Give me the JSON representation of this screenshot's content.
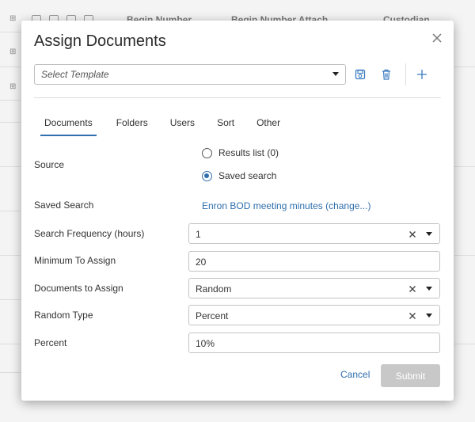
{
  "background": {
    "columns": [
      "Begin Number",
      "Begin Number Attach",
      "Custodian"
    ]
  },
  "modal": {
    "title": "Assign Documents",
    "template": {
      "placeholder": "Select Template"
    },
    "tabs": [
      {
        "label": "Documents",
        "active": true
      },
      {
        "label": "Folders",
        "active": false
      },
      {
        "label": "Users",
        "active": false
      },
      {
        "label": "Sort",
        "active": false
      },
      {
        "label": "Other",
        "active": false
      }
    ],
    "source": {
      "label": "Source",
      "options": [
        {
          "label": "Results list (0)",
          "selected": false
        },
        {
          "label": "Saved search",
          "selected": true
        }
      ]
    },
    "saved_search": {
      "label": "Saved Search",
      "value": "Enron BOD meeting minutes (change...)"
    },
    "search_frequency": {
      "label": "Search Frequency (hours)",
      "value": "1"
    },
    "minimum_to_assign": {
      "label": "Minimum To Assign",
      "value": "20"
    },
    "documents_to_assign": {
      "label": "Documents to Assign",
      "value": "Random"
    },
    "random_type": {
      "label": "Random Type",
      "value": "Percent"
    },
    "percent": {
      "label": "Percent",
      "value": "10%"
    },
    "footer": {
      "cancel_label": "Cancel",
      "submit_label": "Submit"
    }
  },
  "colors": {
    "accent": "#2f6fad",
    "disabled": "#c8c8c8"
  },
  "icons": [
    "save-icon",
    "trash-icon",
    "plus-icon",
    "close-icon",
    "clear-icon",
    "chevron-down-icon",
    "tree-icon"
  ]
}
